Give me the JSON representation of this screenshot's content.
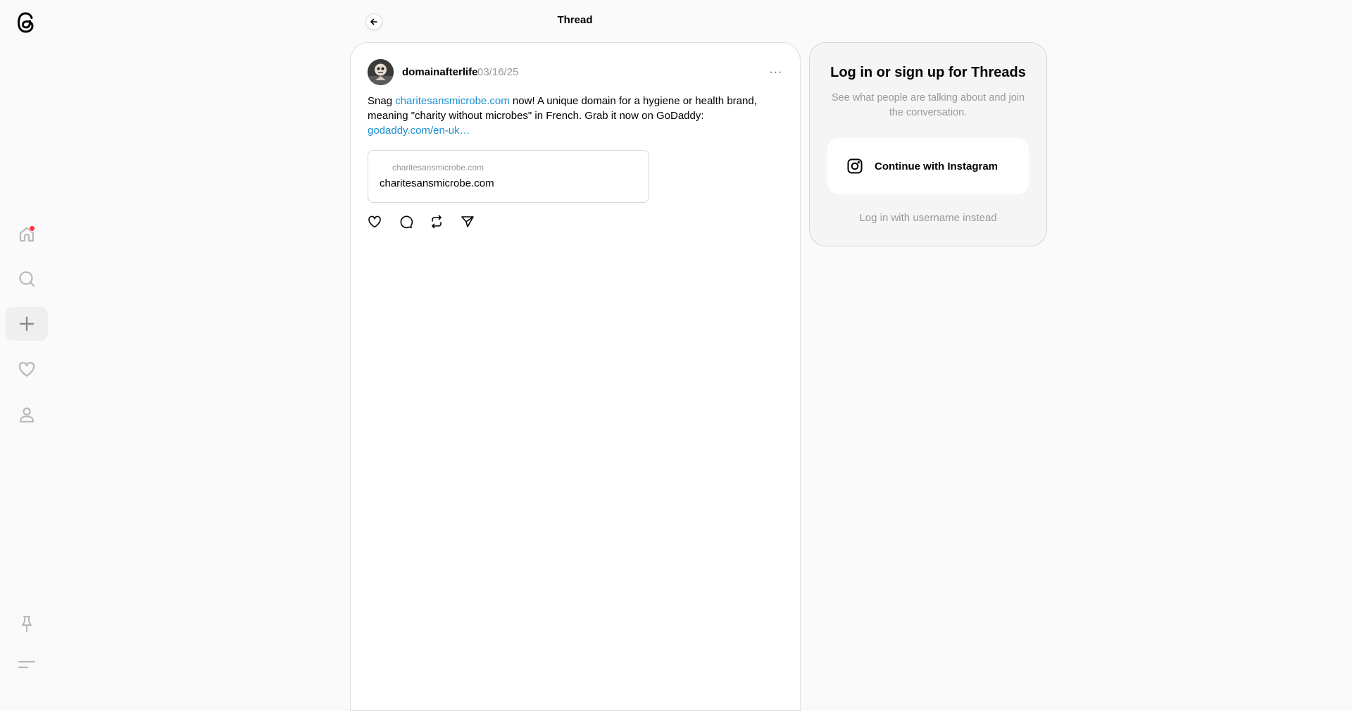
{
  "colors": {
    "background": "#fafafa",
    "link": "#1a8fd0",
    "notification_dot": "#ff3040",
    "muted_text": "#999999"
  },
  "sidebar": {
    "logo_icon": "threads-logo-icon",
    "items": [
      {
        "name": "home",
        "icon": "home-icon",
        "has_notification": true
      },
      {
        "name": "search",
        "icon": "search-icon"
      },
      {
        "name": "create",
        "icon": "plus-icon",
        "active": true
      },
      {
        "name": "activity",
        "icon": "heart-icon"
      },
      {
        "name": "profile",
        "icon": "person-icon"
      }
    ],
    "bottom_items": [
      {
        "name": "pinned",
        "icon": "pin-icon"
      },
      {
        "name": "menu",
        "icon": "menu-icon"
      }
    ]
  },
  "header": {
    "title": "Thread",
    "back_icon": "arrow-left-icon"
  },
  "post": {
    "username": "domainafterlife",
    "timestamp": "03/16/25",
    "more_icon": "ellipsis-icon",
    "text_before_link": "Snag ",
    "inline_link": "charitesansmicrobe.com",
    "text_after_link": " now! A unique domain for a hygiene or health brand, meaning \"charity without microbes\" in French. Grab it now on GoDaddy: ",
    "trailing_link": "godaddy.com/en-uk…",
    "link_preview": {
      "domain": "charitesansmicrobe.com",
      "title": "charitesansmicrobe.com"
    },
    "actions": [
      {
        "name": "like",
        "icon": "heart-icon"
      },
      {
        "name": "reply",
        "icon": "comment-icon"
      },
      {
        "name": "repost",
        "icon": "repost-icon"
      },
      {
        "name": "share",
        "icon": "send-icon"
      }
    ]
  },
  "login": {
    "title": "Log in or sign up for Threads",
    "subtitle": "See what people are talking about and join the conversation.",
    "instagram_button": "Continue with Instagram",
    "instagram_icon": "instagram-icon",
    "alt_login": "Log in with username instead"
  }
}
